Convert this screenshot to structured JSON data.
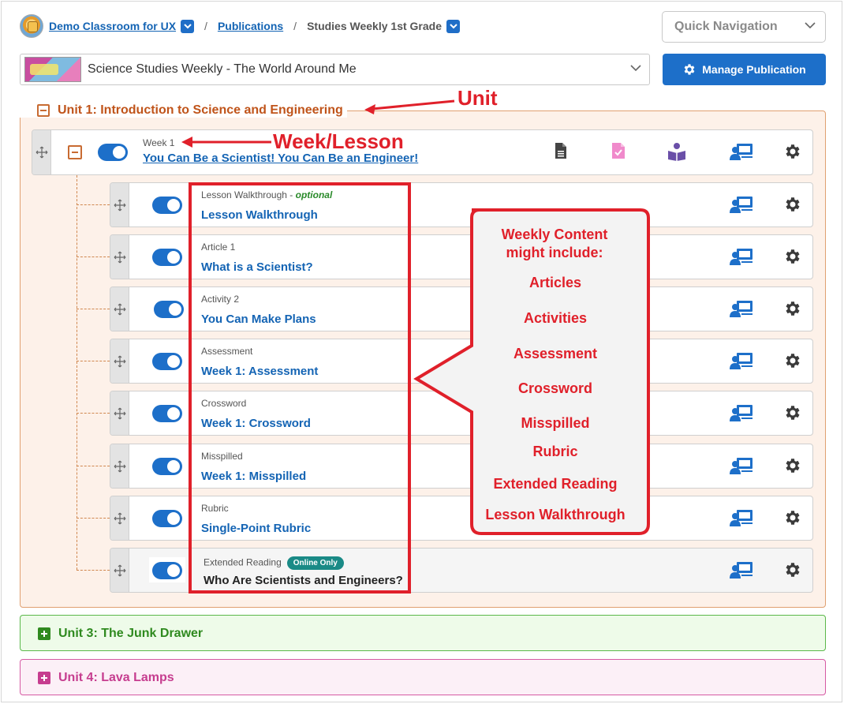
{
  "breadcrumb": {
    "classroom": "Demo Classroom for UX",
    "publications": "Publications",
    "current": "Studies Weekly 1st Grade"
  },
  "quick_nav": {
    "placeholder": "Quick Navigation"
  },
  "publication": {
    "selected": "Science Studies Weekly - The World Around Me"
  },
  "manage_button": "Manage Publication",
  "unit1": {
    "title": "Unit 1: Introduction to Science and Engineering",
    "week": {
      "label": "Week 1",
      "title": "You Can Be a Scientist! You Can Be an Engineer!"
    },
    "items": [
      {
        "type": "Lesson Walkthrough",
        "optional": "optional",
        "title": "Lesson Walkthrough"
      },
      {
        "type": "Article 1",
        "title": "What is a Scientist?"
      },
      {
        "type": "Activity 2",
        "title": "You Can Make Plans"
      },
      {
        "type": "Assessment",
        "title": "Week 1: Assessment"
      },
      {
        "type": "Crossword",
        "title": "Week 1: Crossword"
      },
      {
        "type": "Misspilled",
        "title": "Week 1: Misspilled"
      },
      {
        "type": "Rubric",
        "title": "Single-Point Rubric"
      },
      {
        "type": "Extended Reading",
        "badge": "Online Only",
        "title": "Who Are Scientists and Engineers?"
      }
    ]
  },
  "unit3": {
    "title": "Unit 3: The Junk Drawer"
  },
  "unit4": {
    "title": "Unit 4: Lava Lamps"
  },
  "annotations": {
    "unit": "Unit",
    "week": "Week/Lesson",
    "callout_title": "Weekly Content might include:",
    "callout_items": [
      "Articles",
      "Activities",
      "Assessment",
      "Crossword",
      "Misspilled",
      "Rubric",
      "Extended Reading",
      "Lesson Walkthrough"
    ]
  },
  "colors": {
    "accent_blue": "#1d6fc9",
    "unit1_orange": "#c0541a",
    "unit3_green": "#2f8a1f",
    "unit4_pink": "#c63d8f",
    "annotation_red": "#e0202a"
  },
  "separator": "/",
  "optional_sep": " - "
}
